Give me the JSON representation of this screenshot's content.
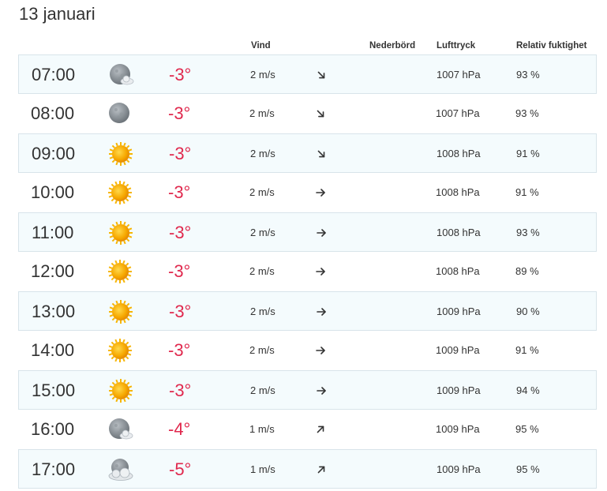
{
  "date_title": "13 januari",
  "headers": {
    "wind": "Vind",
    "precipitation": "Nederbörd",
    "pressure": "Lufttryck",
    "humidity": "Relativ fuktighet"
  },
  "colors": {
    "temperature": "#e0284d",
    "row_shade": "#f4fbfd",
    "row_border": "#d8e4ea",
    "sun": "#f6a800"
  },
  "rows": [
    {
      "time": "07:00",
      "icon": "moon-cloud-icon",
      "temp": "-3°",
      "wind": "2 m/s",
      "wind_dir_deg": 135,
      "precip": "",
      "pressure": "1007 hPa",
      "humidity": "93 %"
    },
    {
      "time": "08:00",
      "icon": "moon-icon",
      "temp": "-3°",
      "wind": "2 m/s",
      "wind_dir_deg": 135,
      "precip": "",
      "pressure": "1007 hPa",
      "humidity": "93 %"
    },
    {
      "time": "09:00",
      "icon": "sun-icon",
      "temp": "-3°",
      "wind": "2 m/s",
      "wind_dir_deg": 135,
      "precip": "",
      "pressure": "1008 hPa",
      "humidity": "91 %"
    },
    {
      "time": "10:00",
      "icon": "sun-icon",
      "temp": "-3°",
      "wind": "2 m/s",
      "wind_dir_deg": 90,
      "precip": "",
      "pressure": "1008 hPa",
      "humidity": "91 %"
    },
    {
      "time": "11:00",
      "icon": "sun-icon",
      "temp": "-3°",
      "wind": "2 m/s",
      "wind_dir_deg": 90,
      "precip": "",
      "pressure": "1008 hPa",
      "humidity": "93 %"
    },
    {
      "time": "12:00",
      "icon": "sun-icon",
      "temp": "-3°",
      "wind": "2 m/s",
      "wind_dir_deg": 90,
      "precip": "",
      "pressure": "1008 hPa",
      "humidity": "89 %"
    },
    {
      "time": "13:00",
      "icon": "sun-icon",
      "temp": "-3°",
      "wind": "2 m/s",
      "wind_dir_deg": 90,
      "precip": "",
      "pressure": "1009 hPa",
      "humidity": "90 %"
    },
    {
      "time": "14:00",
      "icon": "sun-icon",
      "temp": "-3°",
      "wind": "2 m/s",
      "wind_dir_deg": 90,
      "precip": "",
      "pressure": "1009 hPa",
      "humidity": "91 %"
    },
    {
      "time": "15:00",
      "icon": "sun-icon",
      "temp": "-3°",
      "wind": "2 m/s",
      "wind_dir_deg": 90,
      "precip": "",
      "pressure": "1009 hPa",
      "humidity": "94 %"
    },
    {
      "time": "16:00",
      "icon": "moon-cloud-icon",
      "temp": "-4°",
      "wind": "1 m/s",
      "wind_dir_deg": 45,
      "precip": "",
      "pressure": "1009 hPa",
      "humidity": "95 %"
    },
    {
      "time": "17:00",
      "icon": "moon-cloudy-icon",
      "temp": "-5°",
      "wind": "1 m/s",
      "wind_dir_deg": 45,
      "precip": "",
      "pressure": "1009 hPa",
      "humidity": "95 %"
    }
  ]
}
